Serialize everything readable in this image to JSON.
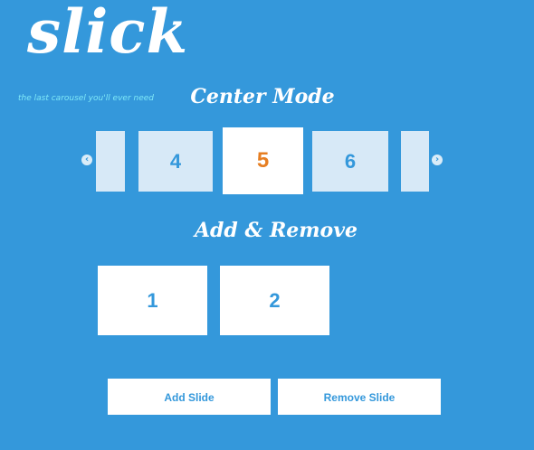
{
  "header": {
    "logo_text": "slick",
    "tagline": "the last carousel you'll ever need"
  },
  "center_mode": {
    "title": "Center Mode",
    "prev_arrow": "‹",
    "next_arrow": "›",
    "slides": [
      "4",
      "5",
      "6"
    ],
    "active_slide": "5"
  },
  "add_remove": {
    "title": "Add & Remove",
    "slides": [
      "1",
      "2"
    ],
    "add_button": "Add Slide",
    "remove_button": "Remove Slide"
  },
  "colors": {
    "background": "#3498db",
    "active_number": "#e67e22",
    "tagline": "#7fe9f8"
  }
}
